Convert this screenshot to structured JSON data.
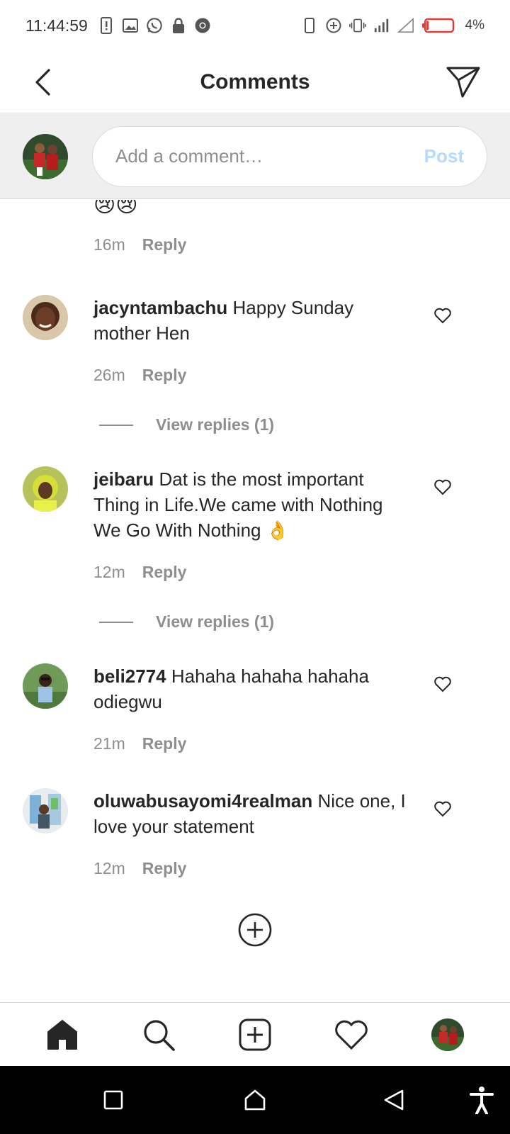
{
  "status_bar": {
    "time": "11:44:59",
    "battery_percent": "4%",
    "icons_left": [
      "sim-alert-icon",
      "image-icon",
      "whatsapp-icon",
      "lock-icon",
      "chrome-icon"
    ],
    "icons_right": [
      "phone-icon",
      "data-saver-icon",
      "vibrate-icon",
      "signal-icon",
      "signal-empty-icon",
      "battery-low-icon"
    ]
  },
  "header": {
    "title": "Comments"
  },
  "comment_input": {
    "placeholder": "Add a comment…",
    "post_label": "Post"
  },
  "colors": {
    "post_disabled": "#b3dbff",
    "meta_gray": "#8e8e8e",
    "text": "#262626"
  },
  "comments": [
    {
      "user": "",
      "text": "😢😢",
      "time": "16m",
      "reply_label": "Reply"
    },
    {
      "user": "jacyntambachu",
      "text": "Happy Sunday mother Hen",
      "time": "26m",
      "reply_label": "Reply",
      "view_replies": "View replies (1)"
    },
    {
      "user": "jeibaru",
      "text": "Dat is the most important Thing in Life.We came with Nothing We Go With Nothing 👌",
      "time": "12m",
      "reply_label": "Reply",
      "view_replies": "View replies (1)"
    },
    {
      "user": "beli2774",
      "text": "Hahaha hahaha hahaha odiegwu",
      "time": "21m",
      "reply_label": "Reply"
    },
    {
      "user": "oluwabusayomi4realman",
      "text": "Nice one, I love your statement",
      "time": "12m",
      "reply_label": "Reply"
    }
  ],
  "bottom_nav": [
    "home-icon",
    "search-icon",
    "new-post-icon",
    "activity-heart-icon",
    "profile-avatar"
  ],
  "system_nav": [
    "recents-icon",
    "home-icon",
    "back-icon",
    "accessibility-icon"
  ]
}
